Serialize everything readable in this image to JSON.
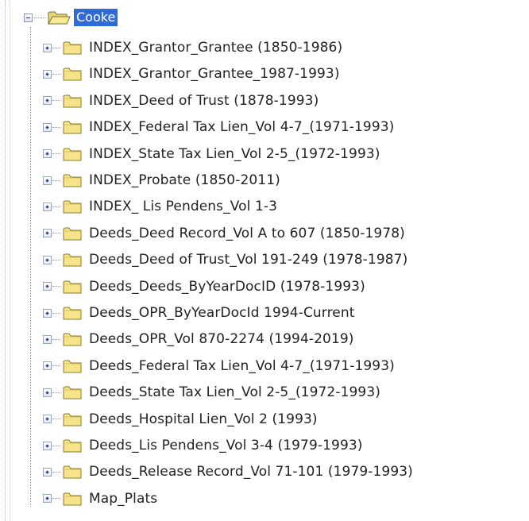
{
  "tree": {
    "root": {
      "label": "Cooke",
      "expanded": true,
      "icon": "open-folder-icon"
    },
    "children": [
      {
        "label": "INDEX_Grantor_Grantee (1850-1986)",
        "icon": "folder-icon"
      },
      {
        "label": "INDEX_Grantor_Grantee_1987-1993)",
        "icon": "folder-icon"
      },
      {
        "label": "INDEX_Deed of Trust (1878-1993)",
        "icon": "folder-icon"
      },
      {
        "label": "INDEX_Federal Tax Lien_Vol 4-7_(1971-1993)",
        "icon": "folder-icon"
      },
      {
        "label": "INDEX_State Tax Lien_Vol 2-5_(1972-1993)",
        "icon": "folder-icon"
      },
      {
        "label": "INDEX_Probate (1850-2011)",
        "icon": "folder-icon"
      },
      {
        "label": "INDEX_ Lis Pendens_Vol 1-3",
        "icon": "folder-icon"
      },
      {
        "label": "Deeds_Deed Record_Vol A to 607 (1850-1978)",
        "icon": "folder-icon"
      },
      {
        "label": "Deeds_Deed of Trust_Vol 191-249 (1978-1987)",
        "icon": "folder-icon"
      },
      {
        "label": "Deeds_Deeds_ByYearDocID (1978-1993)",
        "icon": "folder-icon"
      },
      {
        "label": "Deeds_OPR_ByYearDocId 1994-Current",
        "icon": "folder-icon"
      },
      {
        "label": "Deeds_OPR_Vol 870-2274 (1994-2019)",
        "icon": "folder-icon"
      },
      {
        "label": "Deeds_Federal Tax Lien_Vol 4-7_(1971-1993)",
        "icon": "folder-icon"
      },
      {
        "label": "Deeds_State Tax Lien_Vol 2-5_(1972-1993)",
        "icon": "folder-icon"
      },
      {
        "label": "Deeds_Hospital Lien_Vol 2 (1993)",
        "icon": "folder-icon"
      },
      {
        "label": "Deeds_Lis Pendens_Vol 3-4 (1979-1993)",
        "icon": "folder-icon"
      },
      {
        "label": "Deeds_Release Record_Vol 71-101 (1979-1993)",
        "icon": "folder-icon"
      },
      {
        "label": "Map_Plats",
        "icon": "folder-icon"
      }
    ]
  },
  "colors": {
    "selection": "#2f6bd6",
    "folder_fill": "#f7e48a",
    "folder_stroke": "#8a7a2e"
  }
}
